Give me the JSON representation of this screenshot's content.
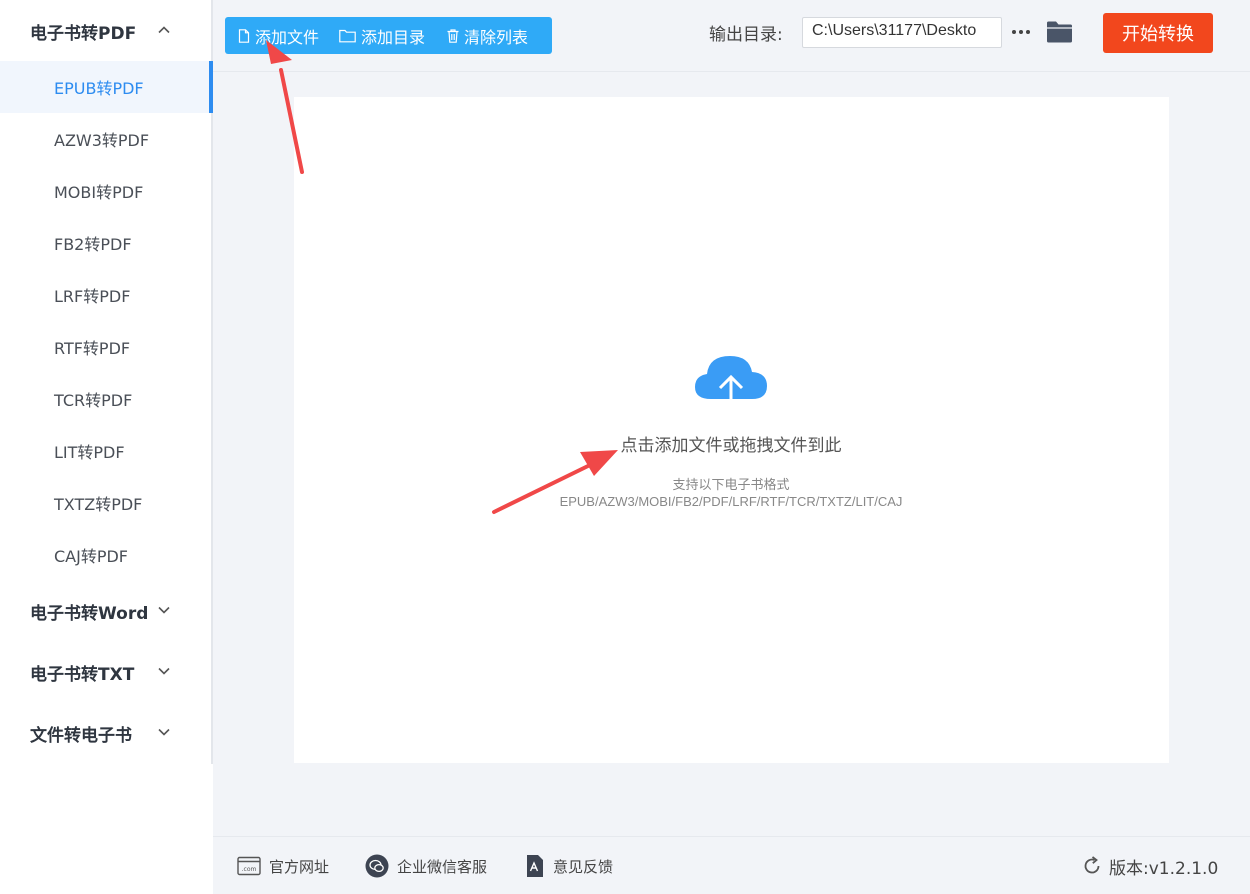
{
  "sidebar": {
    "groups": [
      {
        "label": "电子书转PDF",
        "expanded": true
      },
      {
        "label": "电子书转Word",
        "expanded": false
      },
      {
        "label": "电子书转TXT",
        "expanded": false
      },
      {
        "label": "文件转电子书",
        "expanded": false
      }
    ],
    "items": [
      {
        "label": "EPUB转PDF",
        "active": true
      },
      {
        "label": "AZW3转PDF"
      },
      {
        "label": "MOBI转PDF"
      },
      {
        "label": "FB2转PDF"
      },
      {
        "label": "LRF转PDF"
      },
      {
        "label": "RTF转PDF"
      },
      {
        "label": "TCR转PDF"
      },
      {
        "label": "LIT转PDF"
      },
      {
        "label": "TXTZ转PDF"
      },
      {
        "label": "CAJ转PDF"
      }
    ]
  },
  "toolbar": {
    "add_file": "添加文件",
    "add_folder": "添加目录",
    "clear_list": "清除列表",
    "output_label": "输出目录:",
    "output_path": "C:\\Users\\31177\\Deskto",
    "start": "开始转换"
  },
  "drop_area": {
    "title": "点击添加文件或拖拽文件到此",
    "subtitle": "支持以下电子书格式",
    "formats": "EPUB/AZW3/MOBI/FB2/PDF/LRF/RTF/TCR/TXTZ/LIT/CAJ"
  },
  "footer": {
    "website": "官方网址",
    "wechat": "企业微信客服",
    "feedback": "意见反馈",
    "version": "版本:v1.2.1.0"
  },
  "colors": {
    "accent": "#2d8cf0",
    "toolbar_blue": "#2faaf7",
    "start_orange": "#f2471d",
    "arrow_red": "#f04848"
  },
  "icons": [
    "file-icon",
    "folder-outline-icon",
    "trash-icon",
    "more-icon",
    "folder-icon",
    "cloud-upload-icon",
    "website-icon",
    "wechat-icon",
    "feedback-icon",
    "refresh-icon",
    "chevron-up-icon",
    "chevron-down-icon"
  ]
}
